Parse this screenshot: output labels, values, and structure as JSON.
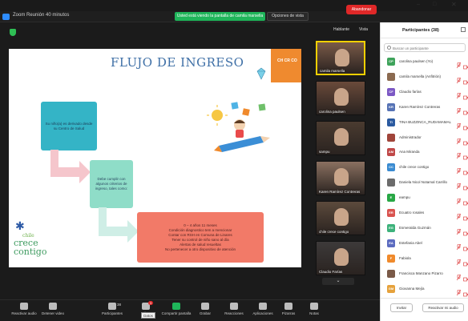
{
  "titlebar": {
    "app_title": "Zoom Reunión 40 minutos",
    "share_banner": "Usted está viendo la pantalla de camila marsella",
    "view_options": "Opciones de vista"
  },
  "meeting": {
    "speaker_label": "Hablante",
    "view_label": "Vista"
  },
  "slide": {
    "title": "FLUJO DE INGRESO",
    "corner_logo": "CH CR CO",
    "box1": "Su niño(a) es derivado desde su Centro de Salud",
    "box2": "Debe cumplir con algunos criterios de ingreso, tales como:",
    "box3_lines": [
      "0 – 4 años 11 meses",
      "Condición diagnostico tem a mencionar",
      "Contar con RSH en Comuna de Linares",
      "Tener su control de niño sano al día",
      "Alertas de salud resueltas",
      "No pertenecer a otro dispositivo de atención"
    ],
    "brand_small": "chile",
    "brand_line1": "crece",
    "brand_line2": "contigo"
  },
  "gallery": [
    {
      "label": "camila marsella",
      "bg": "#7a5a48",
      "active": true
    },
    {
      "label": "carolina paulsen",
      "bg": "#6a4a3a",
      "active": false
    },
    {
      "label": "sampu",
      "bg": "#4a3b30",
      "active": false
    },
    {
      "label": "Karen Ramírez Contreras",
      "bg": "#8a7060",
      "active": false
    },
    {
      "label": "chile crece contigo",
      "bg": "#5c4a3c",
      "active": false
    },
    {
      "label": "Claudio Farías",
      "bg": "#3d3a3a",
      "active": false
    }
  ],
  "toolbar": {
    "items": [
      {
        "label": "Reactivar audio",
        "icon": "mic-muted-icon"
      },
      {
        "label": "Detener video",
        "icon": "video-icon"
      },
      {
        "label": "Participantes",
        "icon": "participants-icon",
        "count": "38"
      },
      {
        "label": "Chat",
        "icon": "chat-icon",
        "badge": "3"
      },
      {
        "label": "Compartir pantalla",
        "icon": "share-screen-icon"
      },
      {
        "label": "Grabar",
        "icon": "record-icon"
      },
      {
        "label": "Reacciones",
        "icon": "reactions-icon"
      },
      {
        "label": "Aplicaciones",
        "icon": "apps-icon"
      },
      {
        "label": "Pizarras",
        "icon": "whiteboard-icon"
      },
      {
        "label": "Notas",
        "icon": "notes-icon"
      }
    ],
    "end_label": "Abandonar",
    "tooltip": "Datos"
  },
  "panel": {
    "title": "Participantes (38)",
    "search_placeholder": "Buscar un participante",
    "participants": [
      {
        "initials": "CP",
        "name": "carolina paulsen (Yo)",
        "color": "#3fa35b"
      },
      {
        "initials": "",
        "name": "camila marsella (Anfitrión)",
        "color": "#8b6a50",
        "photo": true
      },
      {
        "initials": "CF",
        "name": "Claudio farías",
        "color": "#7c58c4"
      },
      {
        "initials": "KR",
        "name": "Karen Ramírez Contreras",
        "color": "#5673b5"
      },
      {
        "initials": "TI",
        "name": "TINA BUZZINCA_RUDAMAMAL",
        "color": "#2b5aa0"
      },
      {
        "initials": "",
        "name": "Administrador",
        "color": "#a0453a",
        "photo": true
      },
      {
        "initials": "AM",
        "name": "Ana Miranda",
        "color": "#c04848"
      },
      {
        "initials": "CC",
        "name": "chile crece contigo",
        "color": "#3a8bd1"
      },
      {
        "initials": "",
        "name": "Daniela Nicol Notamal Carrillo",
        "color": "#6b6b6b",
        "photo": true
      },
      {
        "initials": "E",
        "name": "eampu",
        "color": "#28a745"
      },
      {
        "initials": "ER",
        "name": "Ecuatro rosales",
        "color": "#d9534f"
      },
      {
        "initials": "EG",
        "name": "Esmeralda Guzmán",
        "color": "#3db27b"
      },
      {
        "initials": "EA",
        "name": "Estefania Abel",
        "color": "#5b6bc0"
      },
      {
        "initials": "F",
        "name": "Fabiola",
        "color": "#f08a2c"
      },
      {
        "initials": "",
        "name": "Francisca Manzano Pizarro",
        "color": "#7a5a48",
        "photo": true
      },
      {
        "initials": "GM",
        "name": "Giovanna Mejía",
        "color": "#e6a23c"
      }
    ],
    "invite_label": "Invitar",
    "unmute_label": "Reactivar mi audio"
  }
}
